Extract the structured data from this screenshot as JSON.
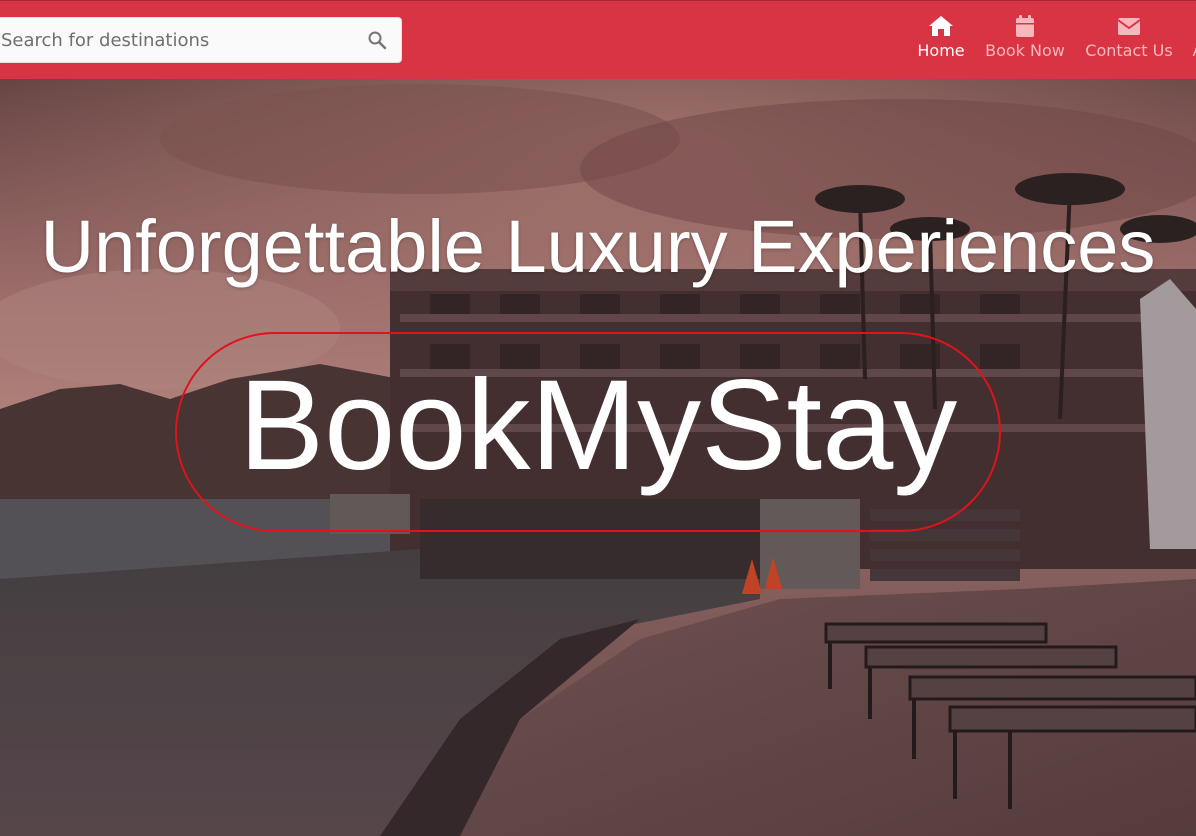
{
  "search": {
    "placeholder": "Search for destinations",
    "icon": "search-icon"
  },
  "nav": {
    "items": [
      {
        "label": "Home",
        "icon": "home-icon",
        "active": true
      },
      {
        "label": "Book Now",
        "icon": "calendar-icon",
        "active": false
      },
      {
        "label": "Contact Us",
        "icon": "envelope-icon",
        "active": false
      }
    ],
    "overflow_label": "A"
  },
  "hero": {
    "subtitle": "Unforgettable Luxury Experiences",
    "brand": "BookMyStay"
  },
  "colors": {
    "navbar": "#d93444",
    "nav_active": "#ffffff",
    "nav_inactive": "#f6b8bd",
    "brand_ring": "#e0131c"
  }
}
